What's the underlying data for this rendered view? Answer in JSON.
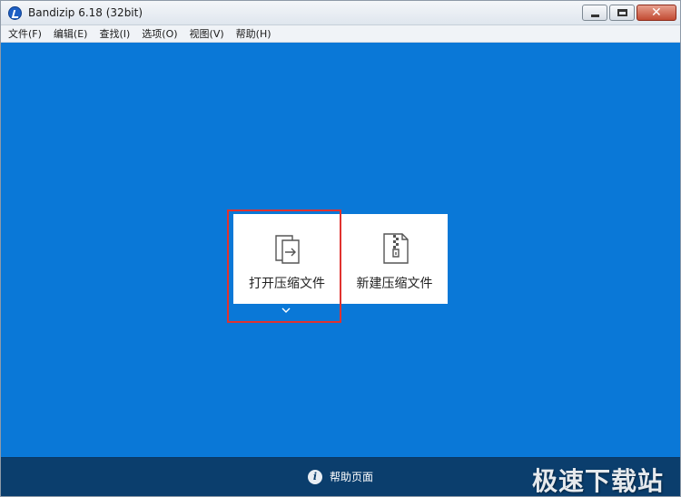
{
  "window": {
    "title": "Bandizip 6.18 (32bit)",
    "close_symbol": "✕"
  },
  "menu": {
    "items": [
      "文件(F)",
      "编辑(E)",
      "查找(I)",
      "选项(O)",
      "视图(V)",
      "帮助(H)"
    ]
  },
  "main": {
    "tiles": [
      {
        "label": "打开压缩文件",
        "icon": "open-archive-icon"
      },
      {
        "label": "新建压缩文件",
        "icon": "zip-file-icon"
      }
    ]
  },
  "footer": {
    "help_label": "帮助页面",
    "info_symbol": "i",
    "watermark": "极速下载站"
  },
  "colors": {
    "main_background": "#0a78d7",
    "footer_background": "#0b3e6d",
    "highlight_border": "#e0322f"
  }
}
